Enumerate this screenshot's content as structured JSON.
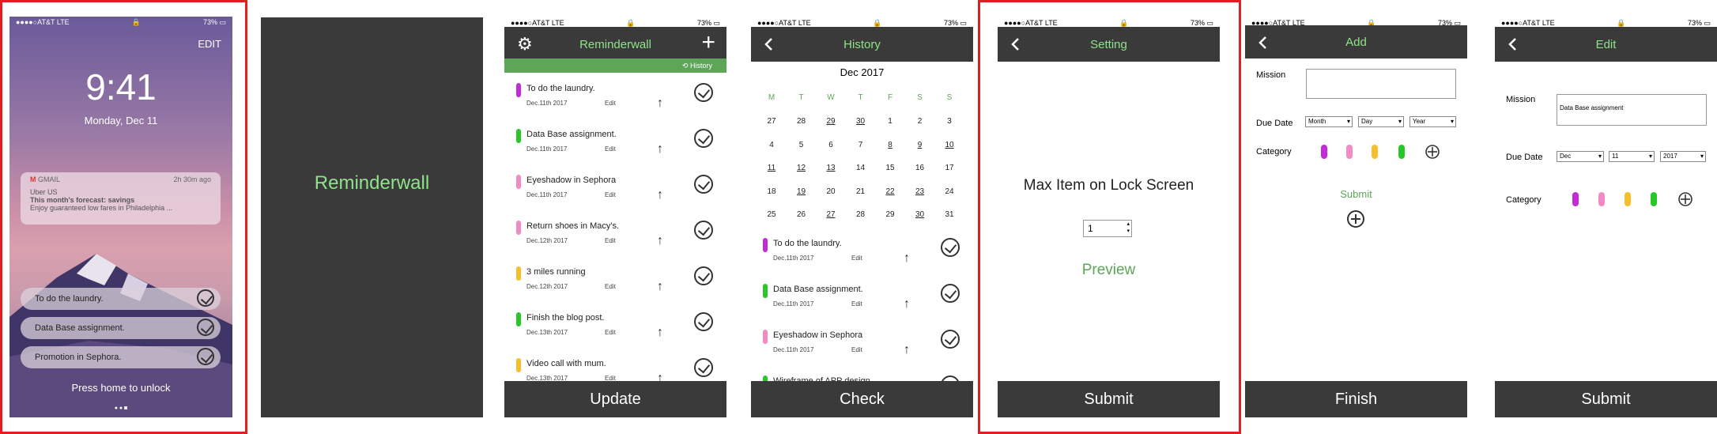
{
  "status": {
    "carrier": "●●●●○AT&T  LTE",
    "battery": "73% ▭"
  },
  "lock": {
    "edit": "EDIT",
    "time": "9:41",
    "date": "Monday, Dec 11",
    "notif_app": "GMAIL",
    "notif_time": "2h 30m ago",
    "notif_sender": "Uber US",
    "notif_subject": "This month's forecast: savings",
    "notif_body": "Enjoy guaranteed low fares in Philadelphia ...",
    "tiles": [
      "To do the laundry.",
      "Data Base assignment.",
      "Promotion in Sephora."
    ],
    "unlock": "Press home to unlock"
  },
  "splash": {
    "title": "Reminderwall"
  },
  "main": {
    "title": "Reminderwall",
    "history": "History",
    "footer": "Update",
    "edit": "Edit",
    "tasks": [
      {
        "title": "To do the laundry.",
        "date": "Dec.11th 2017",
        "color": "#c42bd8"
      },
      {
        "title": "Data Base assignment.",
        "date": "Dec.11th 2017",
        "color": "#27c72a"
      },
      {
        "title": "Eyeshadow in Sephora",
        "date": "Dec.11th 2017",
        "color": "#f28ac3"
      },
      {
        "title": "Return shoes in Macy's.",
        "date": "Dec.12th 2017",
        "color": "#f28ac3"
      },
      {
        "title": "3 miles running",
        "date": "Dec.12th 2017",
        "color": "#f5be2a"
      },
      {
        "title": "Finish the blog post.",
        "date": "Dec.13th 2017",
        "color": "#27c72a"
      },
      {
        "title": "Video call with mum.",
        "date": "Dec.13th 2017",
        "color": "#f5be2a"
      }
    ]
  },
  "history": {
    "title": "History",
    "month": "Dec 2017",
    "footer": "Check",
    "weekdays": [
      "M",
      "T",
      "W",
      "T",
      "F",
      "S",
      "S"
    ],
    "weeks": [
      [
        "27",
        "28",
        "29",
        "30",
        "1",
        "2",
        "3"
      ],
      [
        "4",
        "5",
        "6",
        "7",
        "8",
        "9",
        "10"
      ],
      [
        "11",
        "12",
        "13",
        "14",
        "15",
        "16",
        "17"
      ],
      [
        "18",
        "19",
        "20",
        "21",
        "22",
        "23",
        "24"
      ],
      [
        "25",
        "26",
        "27",
        "28",
        "29",
        "30",
        "31"
      ]
    ],
    "tasks": [
      {
        "title": "To do the laundry.",
        "date": "Dec.11th 2017",
        "color": "#c42bd8"
      },
      {
        "title": "Data Base assignment.",
        "date": "Dec.11th 2017",
        "color": "#27c72a"
      },
      {
        "title": "Eyeshadow in Sephora",
        "date": "Dec.11th 2017",
        "color": "#f28ac3"
      },
      {
        "title": "Wireframe of APP design",
        "date": "",
        "color": "#27c72a"
      }
    ]
  },
  "setting": {
    "title": "Setting",
    "label": "Max Item on Lock Screen",
    "value": "1",
    "preview": "Preview",
    "footer": "Submit"
  },
  "add": {
    "title": "Add",
    "mission": "Mission",
    "due": "Due Date",
    "month": "Month",
    "day": "Day",
    "year": "Year",
    "category": "Category",
    "submit": "Submit",
    "footer": "Finish"
  },
  "edit": {
    "title": "Edit",
    "mission": "Mission",
    "mission_value": "Data Base assignment",
    "due": "Due Date",
    "month": "Dec",
    "day": "11",
    "year": "2017",
    "category": "Category",
    "footer": "Submit"
  },
  "colors": {
    "purple": "#c42bd8",
    "pink": "#f28ac3",
    "yellow": "#f5be2a",
    "green": "#27c72a",
    "accent": "#5da557"
  }
}
